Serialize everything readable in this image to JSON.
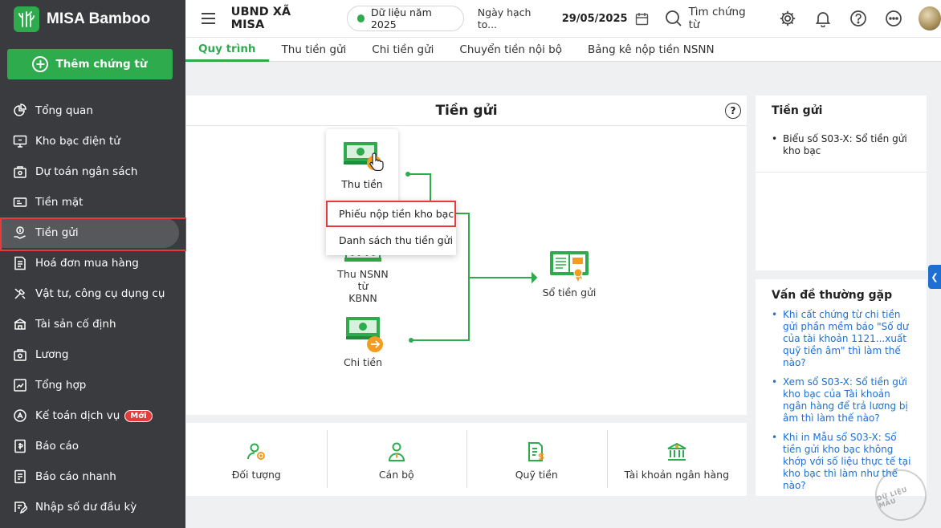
{
  "brand": {
    "name": "MISA Bamboo"
  },
  "sidebar": {
    "add_label": "Thêm chứng từ",
    "items": [
      {
        "label": "Tổng quan"
      },
      {
        "label": "Kho bạc điện tử"
      },
      {
        "label": "Dự toán ngân sách"
      },
      {
        "label": "Tiền mặt"
      },
      {
        "label": "Tiền gửi",
        "active": true
      },
      {
        "label": "Hoá đơn mua hàng"
      },
      {
        "label": "Vật tư, công cụ dụng cụ"
      },
      {
        "label": "Tài sản cố định"
      },
      {
        "label": "Lương"
      },
      {
        "label": "Tổng hợp"
      },
      {
        "label": "Kế toán dịch vụ",
        "badge": "Mới"
      },
      {
        "label": "Báo cáo"
      },
      {
        "label": "Báo cáo nhanh"
      },
      {
        "label": "Nhập số dư đầu kỳ"
      }
    ]
  },
  "header": {
    "org": "UBND XÃ MISA",
    "year_label": "Dữ liệu năm 2025",
    "date_label": "Ngày hạch to...",
    "date_value": "29/05/2025",
    "search_label": "Tìm chứng từ"
  },
  "tabs": [
    {
      "label": "Quy trình",
      "active": true
    },
    {
      "label": "Thu tiền gửi"
    },
    {
      "label": "Chi tiền gửi"
    },
    {
      "label": "Chuyển tiền nội bộ"
    },
    {
      "label": "Bảng kê nộp tiền NSNN"
    }
  ],
  "flow": {
    "title": "Tiền gửi",
    "help": "?",
    "nodes": {
      "thu_tien": "Thu tiền",
      "thu_nsnn_line1": "Thu NSNN từ",
      "thu_nsnn_line2": "KBNN",
      "chi_tien": "Chi tiền",
      "so_tien_gui": "Sổ tiền gửi"
    },
    "dropdown": [
      "Phiếu nộp tiền kho bạc",
      "Danh sách thu tiền gửi"
    ]
  },
  "bottom": [
    "Đối tượng",
    "Cán bộ",
    "Quỹ tiền",
    "Tài khoản ngân hàng"
  ],
  "right_panel": {
    "title": "Tiền gửi",
    "reports": [
      "Biểu số S03-X: Sổ tiền gửi kho bạc"
    ],
    "faq_title": "Vấn đề thường gặp",
    "faq": [
      "Khi cất chứng từ chi tiền gửi phần mềm báo \"Số dư của tài khoản 1121...xuất quỹ tiền âm\" thì làm thế nào?",
      "Xem sổ S03-X: Sổ tiền gửi kho bạc của Tài khoản ngân hàng để trả lương bị âm thì làm thế nào?",
      "Khi in Mẫu sổ S03-X: Sổ tiền gửi kho bạc không khớp với số liệu thực tế tại kho bạc thì làm như thế nào?"
    ]
  },
  "watermark": "DỮ LIỆU MẪU",
  "colors": {
    "accent": "#2eab4d",
    "sidebar": "#393b3f",
    "highlight": "#e63b3b",
    "link": "#1e6fd4"
  }
}
